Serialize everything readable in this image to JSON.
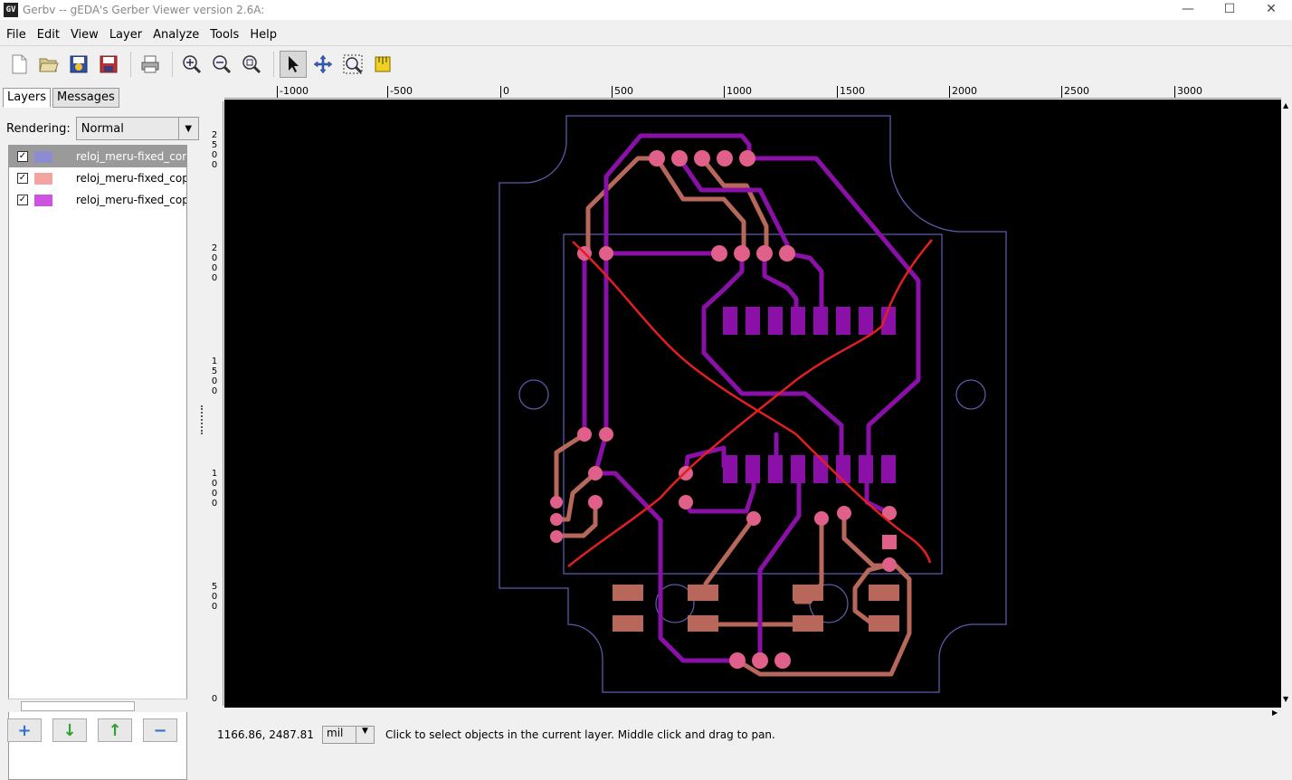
{
  "window": {
    "title": "Gerbv -- gEDA's Gerber Viewer version 2.6A:",
    "icon_label": "GV",
    "controls": {
      "minimize": "—",
      "maximize": "☐",
      "close": "✕"
    }
  },
  "menu": [
    "File",
    "Edit",
    "View",
    "Layer",
    "Analyze",
    "Tools",
    "Help"
  ],
  "toolbar": {
    "buttons": [
      "new-file-icon",
      "open-icon",
      "revert-icon",
      "save-icon",
      "print-icon",
      "zoom-in-icon",
      "zoom-out-icon",
      "zoom-fit-icon",
      "pointer-icon",
      "pan-icon",
      "zoom-area-icon",
      "measure-icon"
    ]
  },
  "sidebar": {
    "tabs": [
      "Layers",
      "Messages"
    ],
    "rendering_label": "Rendering:",
    "rendering_value": "Normal",
    "layers": [
      {
        "name": "reloj_meru-fixed_con",
        "color": "#8c8cd0",
        "checked": true,
        "selected": true
      },
      {
        "name": "reloj_meru-fixed_cop",
        "color": "#f4a4a0",
        "checked": true,
        "selected": false
      },
      {
        "name": "reloj_meru-fixed_cop",
        "color": "#cc55dd",
        "checked": true,
        "selected": false
      }
    ],
    "bottom_buttons": {
      "add": "+",
      "down": "↓",
      "up": "↑",
      "remove": "−"
    }
  },
  "rulers": {
    "h_ticks": [
      "-1000",
      "-500",
      "0",
      "500",
      "1000",
      "1500",
      "2000",
      "2500",
      "3000"
    ],
    "v_ticks": [
      "2500",
      "2000",
      "1500",
      "1000",
      "500",
      "0"
    ]
  },
  "status": {
    "coords": "1166.86, 2487.81",
    "unit": "mil",
    "message": "Click to select objects in the current layer. Middle click and drag to pan."
  },
  "colors": {
    "outline": "#5a5aaa",
    "top_copper": "#8a10a8",
    "bottom_copper": "#b8685a",
    "pad": "#e0608a",
    "ratsnest": "#e02020"
  }
}
